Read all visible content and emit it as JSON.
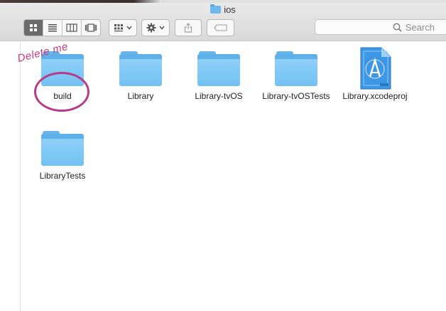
{
  "window": {
    "title": "ios"
  },
  "toolbar": {
    "view_modes": [
      "icon-view",
      "list-view",
      "column-view",
      "cover-flow-view"
    ],
    "active_view": "icon-view",
    "search_placeholder": "Search"
  },
  "files": [
    {
      "name": "build",
      "kind": "folder"
    },
    {
      "name": "Library",
      "kind": "folder"
    },
    {
      "name": "Library-tvOS",
      "kind": "folder"
    },
    {
      "name": "Library-tvOSTests",
      "kind": "folder"
    },
    {
      "name": "Library.xcodeproj",
      "kind": "xcodeproj"
    },
    {
      "name": "LibraryTests",
      "kind": "folder"
    }
  ],
  "annotation": {
    "text": "Delete me",
    "color": "#c8377a"
  },
  "colors": {
    "folder": "#72c1f3",
    "xcode": "#3a93e0"
  }
}
